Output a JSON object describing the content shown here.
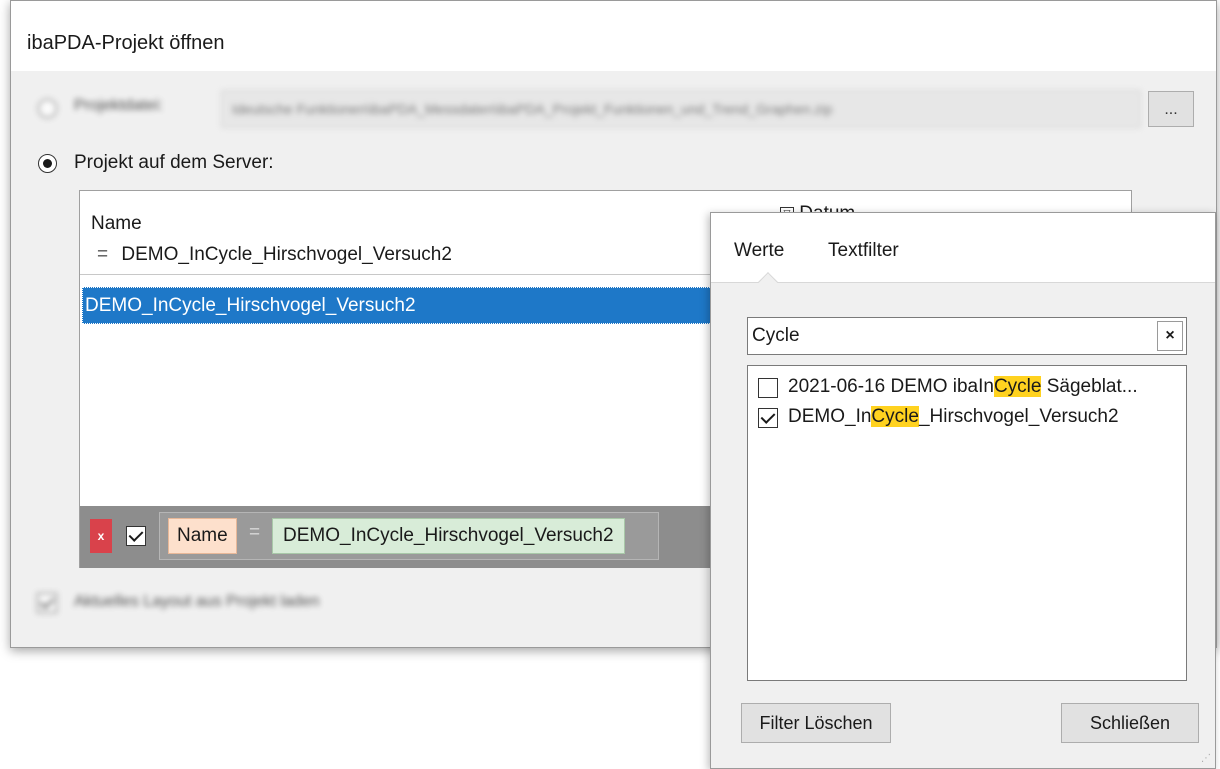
{
  "window": {
    "title": "ibaPDA-Projekt öffnen"
  },
  "file_option": {
    "label": "Projektdatei:",
    "path": "Ideutsche Funktionen\\ibaPDA_Messdaten\\ibaPDA_Projekt_Funktionen_und_Trend_Graphen.zip",
    "browse_label": "..."
  },
  "server_option": {
    "label": "Projekt auf dem Server:"
  },
  "project_list": {
    "columns": {
      "name": "Name",
      "date": "Datum"
    },
    "filter_row": {
      "operator": "=",
      "value": "DEMO_InCycle_Hirschvogel_Versuch2"
    },
    "rows": [
      "DEMO_InCycle_Hirschvogel_Versuch2"
    ],
    "filter_bar": {
      "remove_label": "x",
      "field": "Name",
      "operator": "=",
      "value": "DEMO_InCycle_Hirschvogel_Versuch2"
    }
  },
  "load_layout_option": {
    "label": "Aktuelles Layout aus Projekt laden"
  },
  "filter_popup": {
    "tabs": [
      "Werte",
      "Textfilter"
    ],
    "search_value": "Cycle",
    "clear_label": "×",
    "values": [
      {
        "pre": "2021-06-16 DEMO ibaIn",
        "match": "Cycle",
        "post": " Sägeblat...",
        "checked": false
      },
      {
        "pre": "DEMO_In",
        "match": "Cycle",
        "post": "_Hirschvogel_Versuch2",
        "checked": true
      }
    ],
    "clear_filter_button": "Filter Löschen",
    "close_button": "Schließen"
  }
}
